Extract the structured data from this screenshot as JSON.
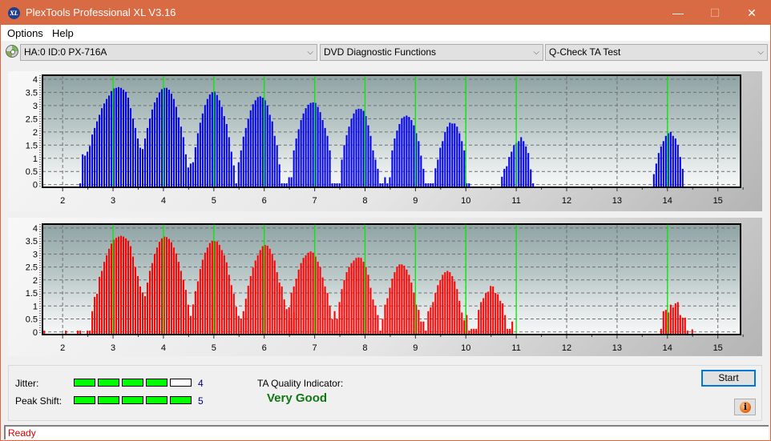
{
  "window": {
    "title": "PlexTools Professional XL V3.16",
    "app_icon": "XL",
    "minimize_glyph": "—",
    "maximize_glyph": "☐",
    "close_glyph": "✕"
  },
  "menu": {
    "items": [
      {
        "label": "Options"
      },
      {
        "label": "Help"
      }
    ]
  },
  "toolbar": {
    "drive_select": {
      "value": "HA:0 ID:0  PX-716A"
    },
    "function_select": {
      "value": "DVD Diagnostic Functions"
    },
    "test_select": {
      "value": "Q-Check TA Test"
    },
    "chevron": "⌵"
  },
  "colors": {
    "top_bars": "#0000ee",
    "bottom_bars": "#ff0000",
    "marker_lines": "#00ee00",
    "accent": "#0078d7",
    "quality": "#117711",
    "status": "#e00000"
  },
  "chart_data": [
    {
      "type": "bar",
      "title": "",
      "series_name": "TA land/pit distribution (top)",
      "color": "#0000ee",
      "xlabel": "",
      "ylabel": "",
      "xlim": [
        1.6,
        15.45
      ],
      "ylim": [
        -0.1,
        4.15
      ],
      "xticks": [
        2,
        3,
        4,
        5,
        6,
        7,
        8,
        9,
        10,
        11,
        12,
        13,
        14,
        15
      ],
      "yticks": [
        0,
        0.5,
        1,
        1.5,
        2,
        2.5,
        3,
        3.5,
        4
      ],
      "ytick_labels": [
        "0",
        "0.5",
        "1",
        "1.5",
        "2",
        "2.5",
        "3",
        "3.5",
        "4"
      ],
      "grid": true,
      "marker_lines_x": [
        3,
        4,
        5,
        6,
        7,
        8,
        9,
        10,
        11,
        14
      ],
      "bin_step": 0.047619,
      "clusters": [
        {
          "start": 2.333,
          "values": [
            0.02,
            1.15,
            1.1,
            1.25,
            1.47,
            1.9,
            2.15,
            2.4,
            2.65,
            2.9,
            3.08,
            3.25,
            3.38,
            3.55,
            3.65,
            3.67,
            3.7,
            3.67,
            3.6,
            3.52,
            3.3,
            2.9,
            2.5,
            2.15,
            1.75,
            1.4,
            1.35,
            1.75,
            2.15,
            2.5,
            2.85,
            3.12,
            3.3,
            3.5,
            3.62,
            3.67,
            3.67,
            3.6,
            3.45,
            3.25,
            2.95,
            2.55,
            2.2,
            1.8,
            1.15,
            0.65,
            0.8,
            0.85,
            1.42,
            1.95,
            2.35,
            2.7,
            3.02,
            3.25,
            3.42,
            3.5,
            3.53,
            3.4,
            3.2,
            2.95,
            2.6,
            2.3,
            1.8,
            1.25,
            0.73,
            0.02
          ]
        },
        {
          "start": 5.476,
          "values": [
            0.85,
            1.3,
            1.82,
            2.15,
            2.5,
            2.82,
            3.05,
            3.2,
            3.32,
            3.35,
            3.3,
            3.2,
            3.0,
            2.65,
            2.4,
            1.85,
            1.5,
            0.77,
            0.02,
            0.02,
            0.02,
            0.28,
            0.28,
            1.3,
            1.75,
            2.1,
            2.45,
            2.7,
            2.9,
            3.03,
            3.1,
            3.12,
            3.1,
            2.95,
            2.75,
            2.45,
            2.15,
            1.85,
            1.3,
            0.02,
            0.02,
            0.02,
            0.02,
            0.95,
            1.5,
            1.88,
            2.2,
            2.5,
            2.7,
            2.85,
            2.88,
            2.87,
            2.8,
            2.6,
            2.25,
            1.85,
            1.3,
            0.95,
            0.6,
            0.02,
            0.02,
            0.28,
            0.02,
            0.28,
            1.3,
            1.75,
            2.05,
            2.3,
            2.52,
            2.58,
            2.62,
            2.57,
            2.45,
            2.25,
            1.95,
            1.65,
            1.1,
            0.6,
            0.02,
            0.02,
            0.02,
            0.02,
            0.62,
            0.95,
            1.4,
            1.65,
            2.0,
            2.2,
            2.35,
            2.32,
            2.32,
            2.2,
            1.95,
            1.65,
            1.3,
            0.02,
            0.02
          ]
        },
        {
          "start": 10.7,
          "values": [
            0.3,
            0.6,
            0.7,
            1.05,
            1.25,
            1.5,
            1.58,
            1.65,
            1.8,
            1.65,
            1.45,
            1.2,
            0.58,
            0.02
          ]
        },
        {
          "start": 13.714,
          "values": [
            0.4,
            0.8,
            1.2,
            1.45,
            1.65,
            1.85,
            1.95,
            2.0,
            1.85,
            1.75,
            1.5,
            1.05,
            0.6
          ]
        }
      ]
    },
    {
      "type": "bar",
      "title": "",
      "series_name": "TA land/pit distribution (bottom)",
      "color": "#ff0000",
      "xlabel": "",
      "ylabel": "",
      "xlim": [
        1.6,
        15.45
      ],
      "ylim": [
        -0.1,
        4.15
      ],
      "xticks": [
        2,
        3,
        4,
        5,
        6,
        7,
        8,
        9,
        10,
        11,
        12,
        13,
        14,
        15
      ],
      "yticks": [
        0,
        0.5,
        1,
        1.5,
        2,
        2.5,
        3,
        3.5,
        4
      ],
      "ytick_labels": [
        "0",
        "0.5",
        "1",
        "1.5",
        "2",
        "2.5",
        "3",
        "3.5",
        "4"
      ],
      "grid": true,
      "marker_lines_x": [
        3,
        4,
        5,
        6,
        7,
        8,
        9,
        10,
        11,
        14
      ],
      "bin_step": 0.047619,
      "clusters": [
        {
          "start": 1.62,
          "values": [
            0.05
          ]
        },
        {
          "start": 2.048,
          "values": [
            0.05
          ]
        },
        {
          "start": 2.286,
          "values": [
            0.05,
            0.05
          ]
        },
        {
          "start": 2.476,
          "values": [
            0.05,
            0.05,
            0.8,
            1.35,
            1.47,
            2.12,
            2.35,
            2.7,
            2.95,
            3.2,
            3.4,
            3.55,
            3.62,
            3.67,
            3.7,
            3.67,
            3.6,
            3.5,
            3.3,
            2.9,
            2.5,
            2.15,
            1.75,
            1.52,
            1.38,
            1.9,
            2.35,
            2.65,
            3.0,
            3.25,
            3.47,
            3.6,
            3.67,
            3.65,
            3.58,
            3.45,
            3.25,
            3.02,
            2.7,
            2.35,
            2.0,
            1.62,
            1.05,
            0.62,
            1.06,
            1.57,
            1.95,
            2.42,
            2.78,
            3.05,
            3.25,
            3.42,
            3.5,
            3.5,
            3.47,
            3.35,
            3.15,
            2.95,
            2.68,
            2.2,
            1.8,
            1.47,
            0.97,
            0.62,
            0.5,
            0.8,
            1.28,
            1.78,
            2.15,
            2.48,
            2.75,
            2.95,
            3.15,
            3.3,
            3.35,
            3.32,
            3.2,
            3.0,
            2.75,
            2.3,
            1.9,
            1.75,
            1.25,
            0.88,
            0.95,
            0.45,
            0.75
          ]
        },
        {
          "start": 6.476,
          "values": [
            0.45,
            1.5,
            1.75,
            2.05,
            2.4,
            2.65,
            2.85,
            2.95,
            3.05,
            3.1,
            3.05,
            2.9,
            2.7,
            2.5,
            2.1,
            1.75,
            1.5,
            1.0,
            0.5,
            0.8,
            0.5,
            1.15,
            1.65,
            2.0,
            2.3,
            2.5,
            2.65,
            2.75,
            2.85,
            2.87,
            2.85,
            2.7,
            2.5,
            2.2,
            1.7,
            1.25,
            1.0,
            0.65,
            0.05,
            0.5,
            1.05,
            1.3,
            1.7,
            2.05,
            2.3,
            2.5,
            2.6,
            2.6,
            2.55,
            2.4,
            2.2,
            1.9,
            1.5,
            1.05,
            0.85,
            0.4,
            0.4,
            0.05,
            0.8,
            0.95,
            1.15,
            1.5,
            1.8,
            2.0,
            2.2,
            2.3,
            2.35,
            2.3,
            2.15,
            1.95,
            1.65,
            1.2,
            0.75,
            0.45,
            0.65,
            0.05,
            0.12,
            0.12,
            0.12,
            0.85,
            1.15,
            1.3,
            1.5,
            1.55,
            1.77,
            1.75,
            1.5,
            1.45,
            1.2,
            1.1,
            0.65,
            0.12,
            0.12,
            0.4
          ]
        },
        {
          "start": 13.857,
          "values": [
            0.12,
            0.8,
            0.85,
            0.75,
            1.05,
            0.95,
            1.1,
            1.15,
            0.65,
            0.55,
            0.55,
            0.05
          ]
        },
        {
          "start": 14.476,
          "values": [
            0.1
          ]
        }
      ]
    }
  ],
  "metrics": {
    "jitter": {
      "label": "Jitter:",
      "value": 4,
      "value_text": "4",
      "max": 5
    },
    "peak_shift": {
      "label": "Peak Shift:",
      "value": 5,
      "value_text": "5",
      "max": 5
    },
    "quality_label": "TA Quality Indicator:",
    "quality_value": "Very Good"
  },
  "buttons": {
    "start_label": "Start",
    "info_glyph": "i"
  },
  "status": {
    "text": "Ready"
  }
}
